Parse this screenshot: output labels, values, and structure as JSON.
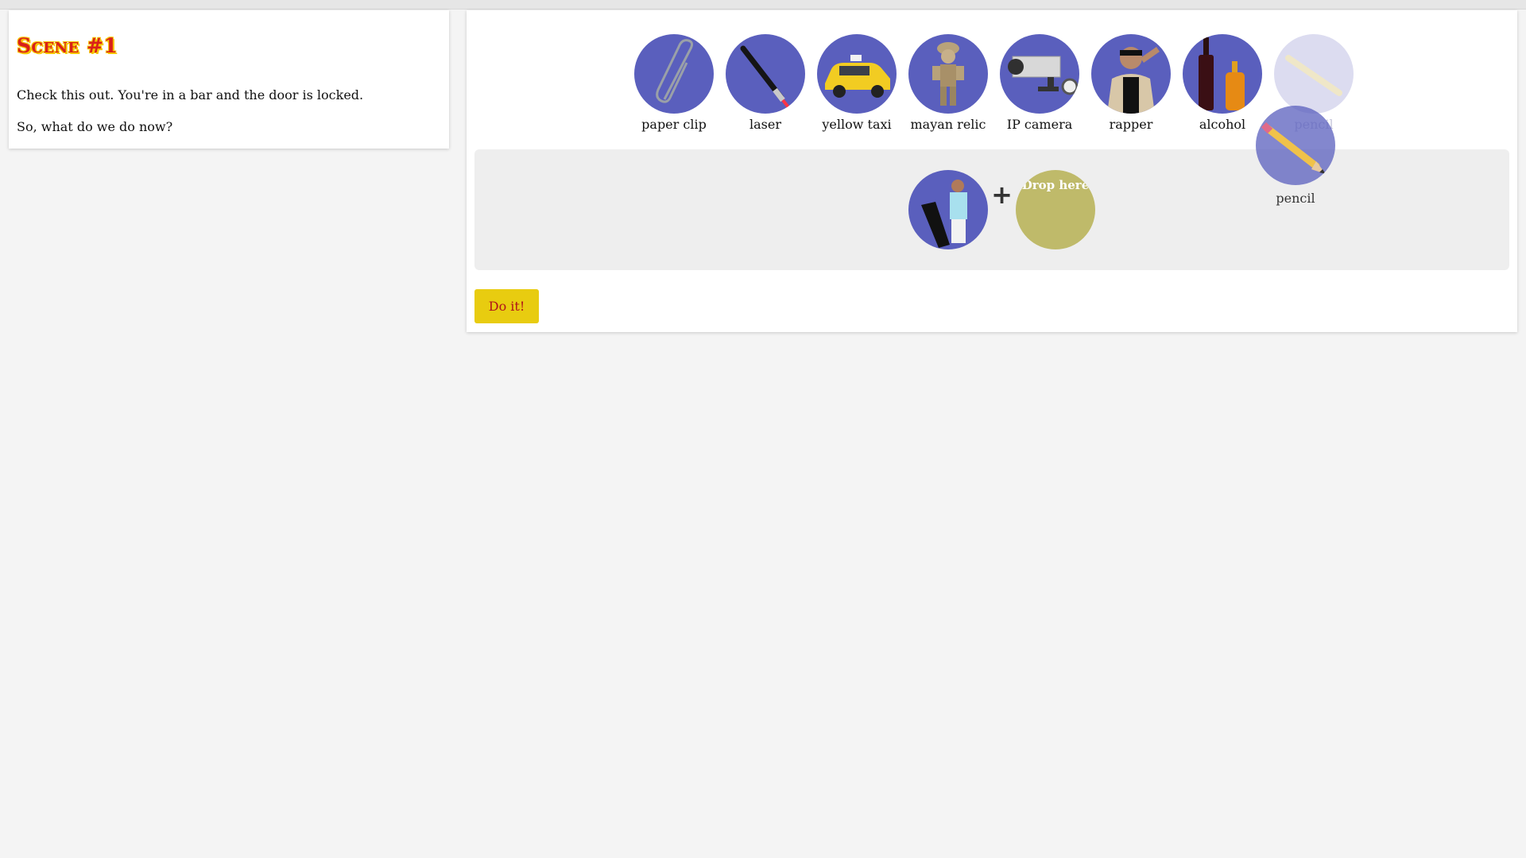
{
  "scene": {
    "title": "Scene #1",
    "lines": [
      "Check this out. You're in a bar and the door is locked.",
      "So, what do we do now?"
    ]
  },
  "inventory": [
    {
      "label": "paper clip",
      "icon": "paper-clip-icon"
    },
    {
      "label": "laser",
      "icon": "laser-pointer-icon"
    },
    {
      "label": "yellow taxi",
      "icon": "taxi-icon"
    },
    {
      "label": "mayan relic",
      "icon": "relic-statue-icon"
    },
    {
      "label": "IP camera",
      "icon": "camera-icon"
    },
    {
      "label": "rapper",
      "icon": "rapper-icon"
    },
    {
      "label": "alcohol",
      "icon": "bottles-icon"
    },
    {
      "label": "pencil",
      "icon": "pencil-icon",
      "state": "being-dragged"
    }
  ],
  "combine": {
    "first_item_icon": "man-with-trousers-icon",
    "plus": "+",
    "drop_placeholder": "Drop here"
  },
  "dragged_item": {
    "label": "pencil",
    "icon": "pencil-icon"
  },
  "action_button": "Do it!",
  "colors": {
    "item_disc": "#5a5fbd",
    "drop_slot": "#bfba6a",
    "button_bg": "#e8cc10",
    "button_text": "#b0121a",
    "title_red": "#d9201a"
  }
}
